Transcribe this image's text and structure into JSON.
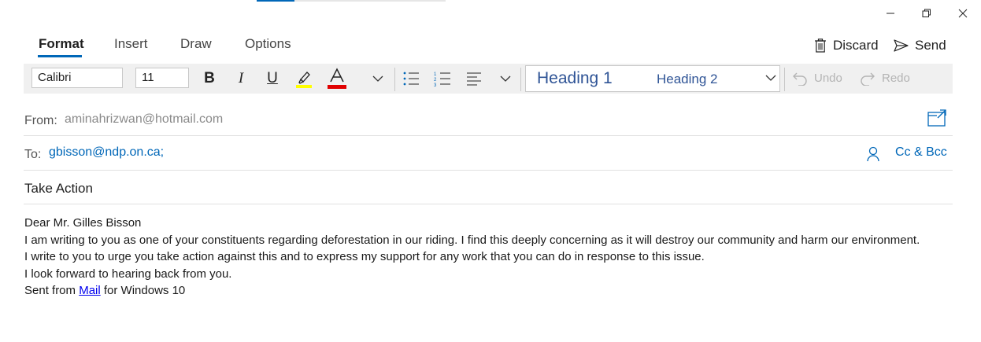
{
  "window_controls": {
    "minimize": "minimize",
    "restore": "restore",
    "close": "close"
  },
  "tabs": [
    {
      "label": "Format",
      "active": true
    },
    {
      "label": "Insert",
      "active": false
    },
    {
      "label": "Draw",
      "active": false
    },
    {
      "label": "Options",
      "active": false
    }
  ],
  "actions": {
    "discard": "Discard",
    "send": "Send"
  },
  "toolbar": {
    "font_name": "Calibri",
    "font_size": "11",
    "styles": {
      "heading1": "Heading 1",
      "heading2": "Heading 2"
    },
    "undo": "Undo",
    "redo": "Redo",
    "highlight_color": "#ffff00",
    "font_color": "#e00000"
  },
  "header": {
    "from_label": "From:",
    "from_value": "aminahrizwan@hotmail.com",
    "to_label": "To:",
    "to_value": "gbisson@ndp.on.ca;",
    "cc_bcc": "Cc & Bcc",
    "subject": "Take Action"
  },
  "body": {
    "greeting": "Dear Mr. Gilles Bisson",
    "p1": "I am writing to you as one of your constituents regarding deforestation in our riding. I find this deeply concerning as it will destroy our community and harm our environment.",
    "p2": "I write to you to urge you take action against this and to express my support for any work that you can do in response to this issue.",
    "p3": "I look forward to hearing back from you.",
    "sig_prefix": "Sent from ",
    "sig_link": "Mail",
    "sig_suffix": " for Windows 10"
  },
  "colors": {
    "accent": "#0067b8",
    "heading": "#2f5496"
  }
}
